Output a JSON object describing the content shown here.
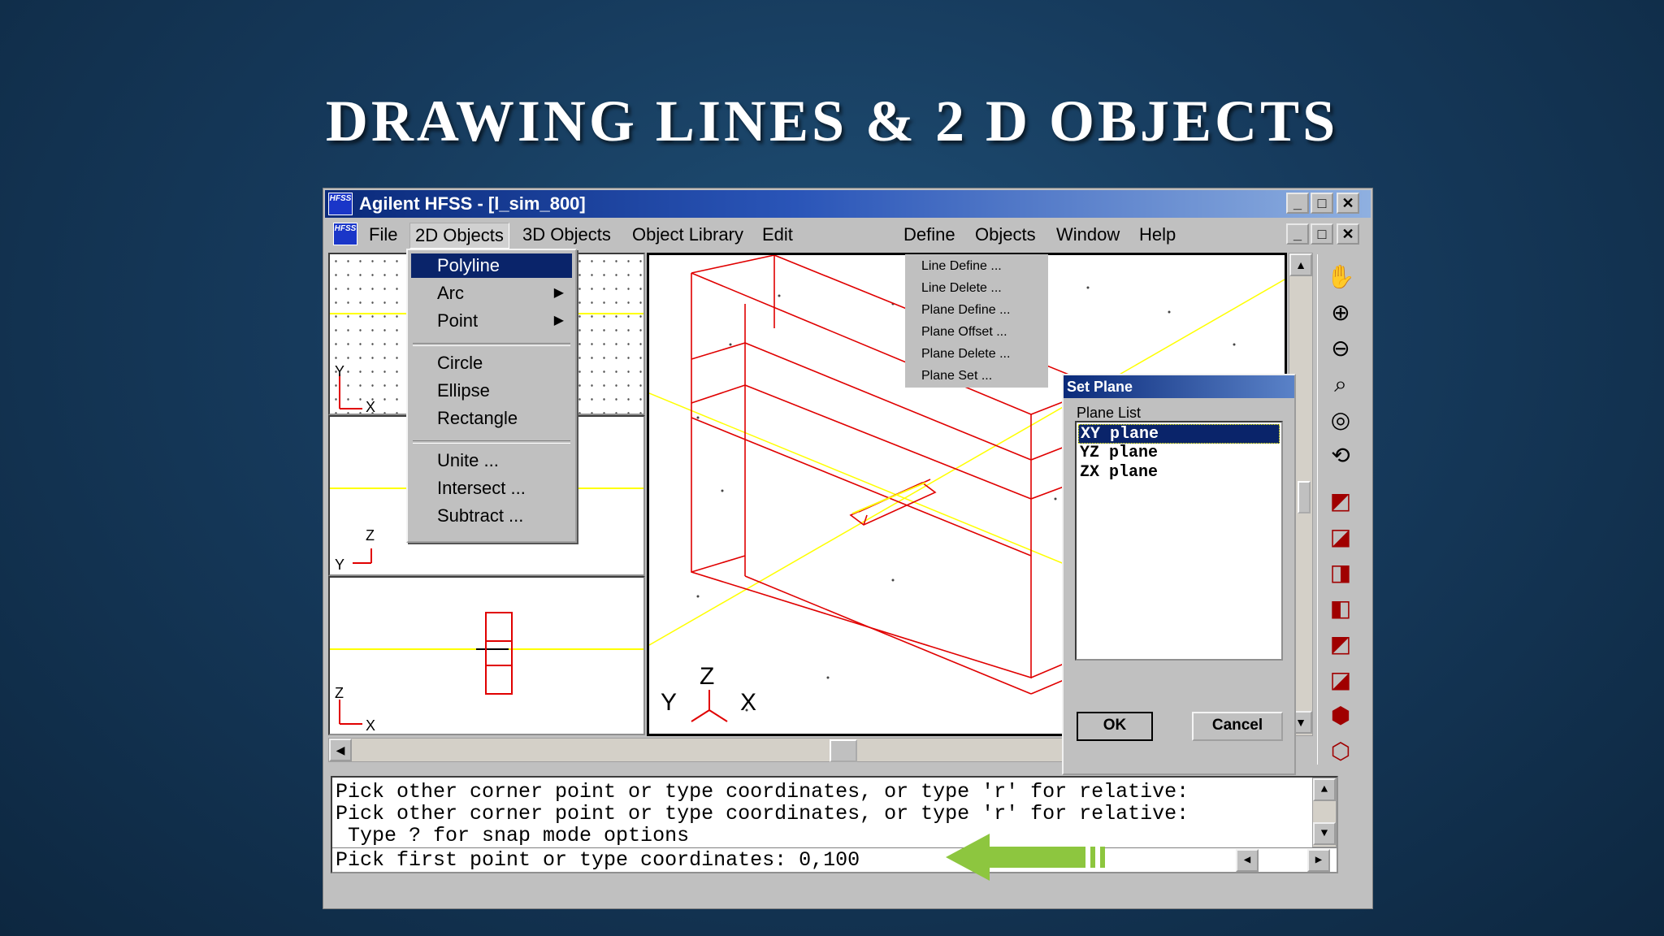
{
  "slide": {
    "title": "Drawing Lines & 2 D Objects"
  },
  "app": {
    "title": "Agilent HFSS - [l_sim_800]",
    "logo_text": "HFSS",
    "window_buttons": {
      "minimize": "_",
      "maximize": "□",
      "close": "✕"
    }
  },
  "menubar": {
    "items": [
      "File",
      "2D Objects",
      "3D Objects",
      "Object Library",
      "Edit",
      "Define",
      "Objects",
      "Window",
      "Help"
    ]
  },
  "menu_2d": {
    "items": [
      "Polyline",
      "Arc",
      "Point",
      "Circle",
      "Ellipse",
      "Rectangle",
      "Unite ...",
      "Intersect ...",
      "Subtract ..."
    ],
    "selected": "Polyline"
  },
  "menu_define": {
    "items": [
      "Line Define ...",
      "Line Delete ...",
      "Plane Define ...",
      "Plane Offset ...",
      "Plane Delete ...",
      "Plane Set ..."
    ]
  },
  "axes": {
    "top_view": {
      "v": "Y",
      "h": "X"
    },
    "side_view": {
      "v": "Z",
      "h": "Y"
    },
    "front_view": {
      "v": "Z",
      "h": "X"
    },
    "iso_view": {
      "z": "Z",
      "y": "Y",
      "x": "X"
    }
  },
  "dialog": {
    "title": "Set Plane",
    "list_label": "Plane List",
    "planes": [
      "XY plane",
      "YZ plane",
      "ZX plane"
    ],
    "selected": "XY plane",
    "ok_label": "OK",
    "cancel_label": "Cancel"
  },
  "console": {
    "lines": [
      "Pick other corner point or type coordinates, or type 'r' for relative:",
      "Pick other corner point or type coordinates, or type 'r' for relative:",
      " Type ? for snap mode options"
    ],
    "prompt": "Pick first point or type coordinates: 0,100"
  },
  "colors": {
    "model_line": "#e00000",
    "grid_line": "#ffff00",
    "highlight": "#0a246a",
    "arrow": "#8dc63f"
  },
  "icons": [
    "hand-icon",
    "zoom-in-icon",
    "zoom-out-icon",
    "zoom-window-icon",
    "zoom-fit-icon",
    "rotate-icon",
    "view-top-icon",
    "view-front-icon",
    "view-side-icon",
    "view-iso-icon",
    "view-back-icon",
    "view-bottom-icon",
    "view-left-icon",
    "view-3d-icon"
  ]
}
